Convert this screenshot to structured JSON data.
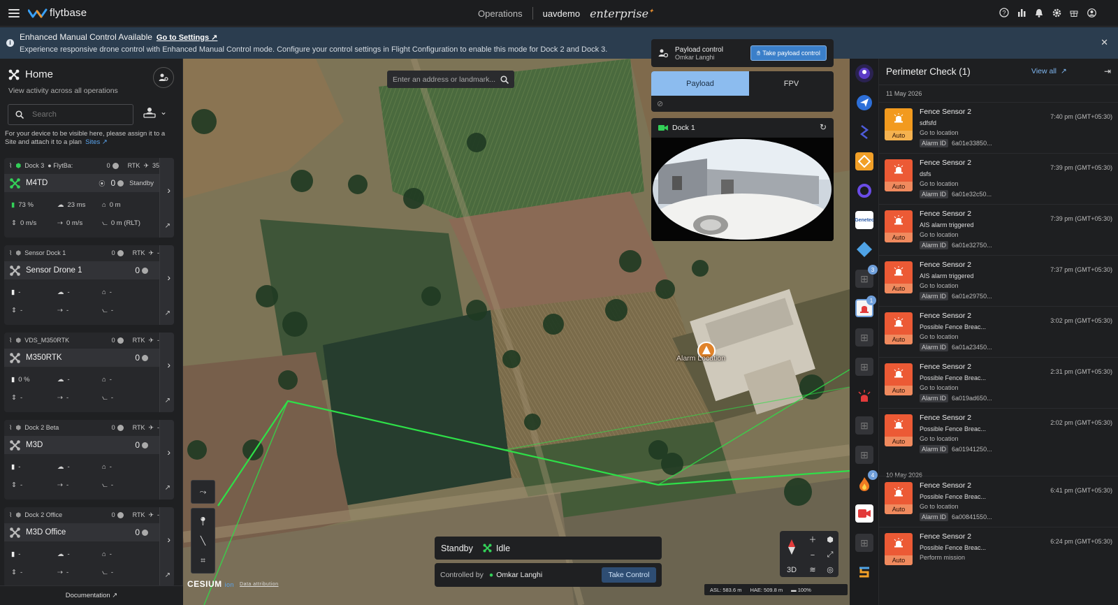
{
  "topbar": {
    "logo_text": "flytbase",
    "operations": "Operations",
    "org": "uavdemo",
    "edition": "enterprise",
    "icons": [
      "help-icon",
      "bar-chart-icon",
      "bell-icon",
      "gear-icon",
      "gift-icon",
      "user-icon"
    ]
  },
  "banner": {
    "title": "Enhanced Manual Control Available",
    "link": "Go to Settings",
    "message": "Experience responsive drone control with Enhanced Manual Control mode. Configure your control settings in Flight Configuration to enable this mode for Dock 2 and Dock 3."
  },
  "home": {
    "title": "Home",
    "subtitle": "View activity across all operations",
    "search_placeholder": "Search",
    "assign_note": "For your device to be visible here, please assign it to a Site and attach it to a plan",
    "sites_link": "Sites",
    "documentation": "Documentation"
  },
  "devices": [
    {
      "dock": "Dock 3",
      "site": "FlytBa:",
      "dock_count": "0",
      "rtk": "RTK",
      "rtk_val": "35",
      "drone": "M4TD",
      "drone_count": "0",
      "status": "Standby",
      "battery": "73 %",
      "latency": "23 ms",
      "home": "0 m",
      "vspeed": "0 m/s",
      "hspeed": "0 m/s",
      "alt": "0 m (RLT)",
      "active": true
    },
    {
      "dock": "Sensor Dock 1",
      "site": "",
      "dock_count": "0",
      "rtk": "RTK",
      "rtk_val": "-",
      "drone": "Sensor Drone 1",
      "drone_count": "0",
      "status": "",
      "battery": "-",
      "latency": "-",
      "home": "-",
      "vspeed": "-",
      "hspeed": "-",
      "alt": "-",
      "active": false
    },
    {
      "dock": "VDS_M350RTK",
      "site": "",
      "dock_count": "0",
      "rtk": "RTK",
      "rtk_val": "-",
      "drone": "M350RTK",
      "drone_count": "0",
      "status": "",
      "battery": "0 %",
      "latency": "-",
      "home": "-",
      "vspeed": "-",
      "hspeed": "-",
      "alt": "-",
      "active": false
    },
    {
      "dock": "Dock 2 Beta",
      "site": "",
      "dock_count": "0",
      "rtk": "RTK",
      "rtk_val": "-",
      "drone": "M3D",
      "drone_count": "0",
      "status": "",
      "battery": "-",
      "latency": "-",
      "home": "-",
      "vspeed": "-",
      "hspeed": "-",
      "alt": "-",
      "active": false
    },
    {
      "dock": "Dock 2 Office",
      "site": "",
      "dock_count": "0",
      "rtk": "RTK",
      "rtk_val": "-",
      "drone": "M3D Office",
      "drone_count": "0",
      "status": "",
      "battery": "-",
      "latency": "-",
      "home": "-",
      "vspeed": "-",
      "hspeed": "-",
      "alt": "-",
      "active": false
    }
  ],
  "map": {
    "search_placeholder": "Enter an address or landmark...",
    "alarm_label": "Alarm Location",
    "cesium": "CESIUM",
    "cesium_ion": "ion",
    "attribution": "Data attribution",
    "view_mode": "3D",
    "asl": "ASL: 583.6 m",
    "hae": "HAE: 509.8 m",
    "battery": "100%"
  },
  "status": {
    "state": "Standby",
    "drone_state": "Idle",
    "controlled_by_label": "Controlled by",
    "controller": "Omkar Langhi",
    "take_control": "Take Control"
  },
  "payload": {
    "title": "Payload control",
    "user": "Omkar Langhi",
    "take_button": "Take payload control",
    "tabs": [
      "Payload",
      "FPV"
    ],
    "dock_label": "Dock 1"
  },
  "right_strip": {
    "badges": [
      "3",
      "1",
      "4"
    ]
  },
  "alerts": {
    "title": "Perimeter Check (1)",
    "view_all": "View all",
    "day1": "11 May 2026",
    "day2": "10 May 2026",
    "auto": "Auto",
    "goto": "Go to location",
    "alarm_id_label": "Alarm ID",
    "items": [
      {
        "title": "Fence Sensor 2",
        "sub": "sdfsfd",
        "action": "Go to location",
        "id": "6a01e33850...",
        "time": "7:40 pm (GMT+05:30)",
        "color": "amber"
      },
      {
        "title": "Fence Sensor 2",
        "sub": "dsfs",
        "action": "Go to location",
        "id": "6a01e32c50...",
        "time": "7:39 pm (GMT+05:30)",
        "color": "red"
      },
      {
        "title": "Fence Sensor 2",
        "sub": "AIS alarm triggered",
        "action": "Go to location",
        "id": "6a01e32750...",
        "time": "7:39 pm (GMT+05:30)",
        "color": "red"
      },
      {
        "title": "Fence Sensor 2",
        "sub": "AIS alarm triggered",
        "action": "Go to location",
        "id": "6a01e29750...",
        "time": "7:37 pm (GMT+05:30)",
        "color": "red"
      },
      {
        "title": "Fence Sensor 2",
        "sub": "Possible Fence Breac...",
        "action": "Go to location",
        "id": "6a01a23450...",
        "time": "3:02 pm (GMT+05:30)",
        "color": "red"
      },
      {
        "title": "Fence Sensor 2",
        "sub": "Possible Fence Breac...",
        "action": "Go to location",
        "id": "6a019ad650...",
        "time": "2:31 pm (GMT+05:30)",
        "color": "red"
      },
      {
        "title": "Fence Sensor 2",
        "sub": "Possible Fence Breac...",
        "action": "Go to location",
        "id": "6a01941250...",
        "time": "2:02 pm (GMT+05:30)",
        "color": "red"
      },
      {
        "title": "Fence Sensor 2",
        "sub": "Possible Fence Breac...",
        "action": "Go to location",
        "id": "6a00841550...",
        "time": "6:41 pm (GMT+05:30)",
        "color": "red"
      },
      {
        "title": "Fence Sensor 2",
        "sub": "Possible Fence Breac...",
        "action": "Perform mission",
        "id": "",
        "time": "6:24 pm (GMT+05:30)",
        "color": "red"
      }
    ]
  }
}
